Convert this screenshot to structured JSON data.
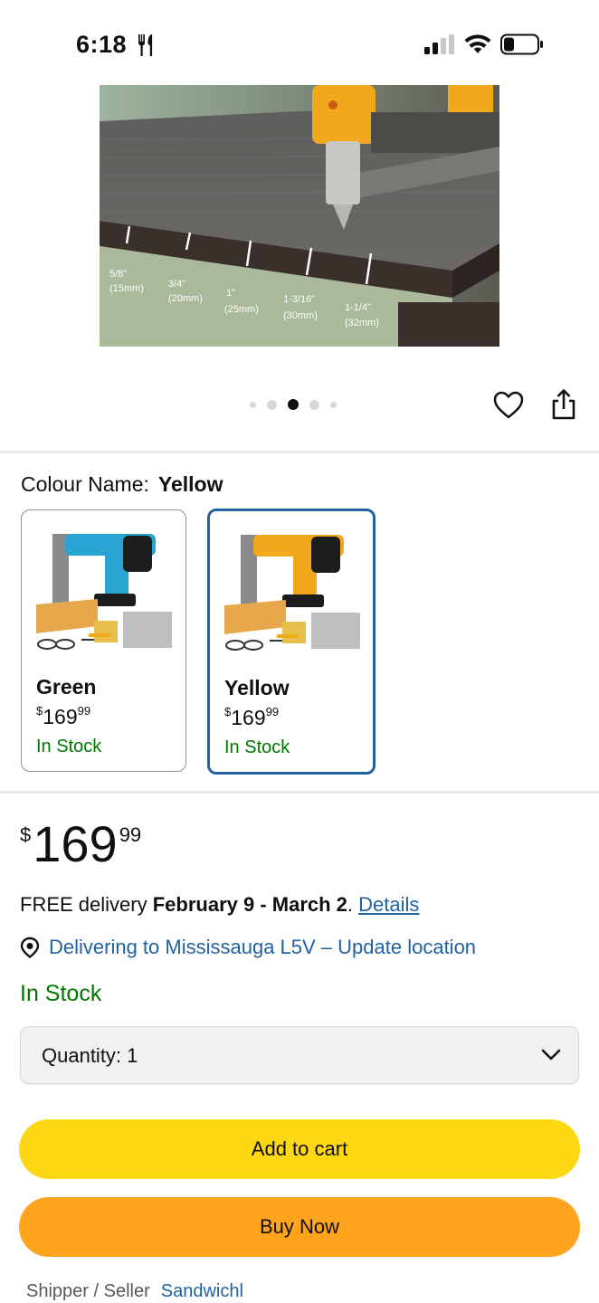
{
  "status_bar": {
    "time": "6:18",
    "icons": [
      "fork-knife-icon",
      "signal-icon",
      "wifi-icon",
      "battery-icon"
    ]
  },
  "product_image": {
    "measurements": [
      {
        "fraction": "5/8\"",
        "metric": "(15mm)"
      },
      {
        "fraction": "3/4\"",
        "metric": "(20mm)"
      },
      {
        "fraction": "1\"",
        "metric": "(25mm)"
      },
      {
        "fraction": "1-3/16\"",
        "metric": "(30mm)"
      },
      {
        "fraction": "1-1/4\"",
        "metric": "(32mm)"
      }
    ]
  },
  "carousel": {
    "count": 5,
    "active_index": 2
  },
  "actions": {
    "wishlist_icon": "heart-icon",
    "share_icon": "share-icon"
  },
  "colour": {
    "label": "Colour Name:",
    "selected": "Yellow",
    "options": [
      {
        "name": "Green",
        "currency": "$",
        "whole": "169",
        "cents": "99",
        "stock": "In Stock",
        "selected": false,
        "color": "#29a3d1"
      },
      {
        "name": "Yellow",
        "currency": "$",
        "whole": "169",
        "cents": "99",
        "stock": "In Stock",
        "selected": true,
        "color": "#f2a81d"
      }
    ]
  },
  "price": {
    "currency": "$",
    "whole": "169",
    "cents": "99"
  },
  "delivery": {
    "prefix": "FREE delivery ",
    "dates": "February 9 - March 2",
    "suffix": ". ",
    "details_link": "Details"
  },
  "location": {
    "text": "Delivering to Mississauga L5V – Update location",
    "icon": "location-pin-icon"
  },
  "stock_status": "In Stock",
  "quantity": {
    "label": "Quantity:",
    "value": "1"
  },
  "buttons": {
    "add_to_cart": "Add to cart",
    "buy_now": "Buy Now"
  },
  "seller": {
    "label": "Shipper / Seller",
    "name": "Sandwichl"
  },
  "colors": {
    "link": "#2162a1",
    "in_stock": "#007600",
    "add_to_cart": "#ffd814",
    "buy_now": "#ffa41c",
    "selected_border": "#2162a1"
  }
}
